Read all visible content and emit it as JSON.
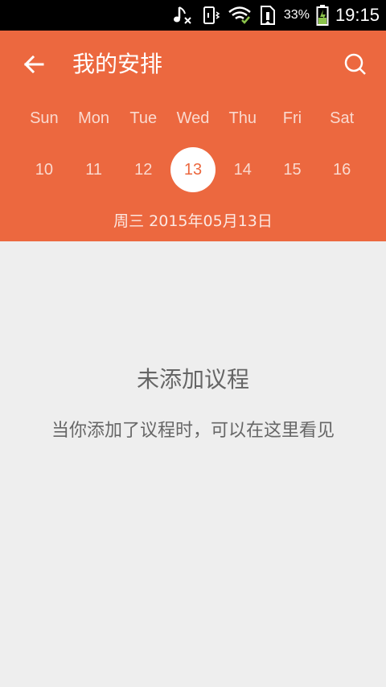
{
  "status_bar": {
    "battery_percent": "33%",
    "time": "19:15",
    "icons": [
      "music-mute-icon",
      "vibrate-icon",
      "wifi-icon",
      "sim-icon",
      "battery-charging-icon"
    ]
  },
  "toolbar": {
    "back_icon": "arrow-left-icon",
    "title": "我的安排",
    "search_icon": "search-icon"
  },
  "calendar": {
    "weekdays": [
      "Sun",
      "Mon",
      "Tue",
      "Wed",
      "Thu",
      "Fri",
      "Sat"
    ],
    "days": [
      "10",
      "11",
      "12",
      "13",
      "14",
      "15",
      "16"
    ],
    "selected_day": "13",
    "selected_date_text": "周三 2015年05月13日"
  },
  "empty_state": {
    "title": "未添加议程",
    "subtitle": "当你添加了议程时，可以在这里看见"
  },
  "colors": {
    "accent": "#ec683f",
    "background": "#eeeeee",
    "status_bar": "#000000",
    "text_gray": "#666666"
  }
}
